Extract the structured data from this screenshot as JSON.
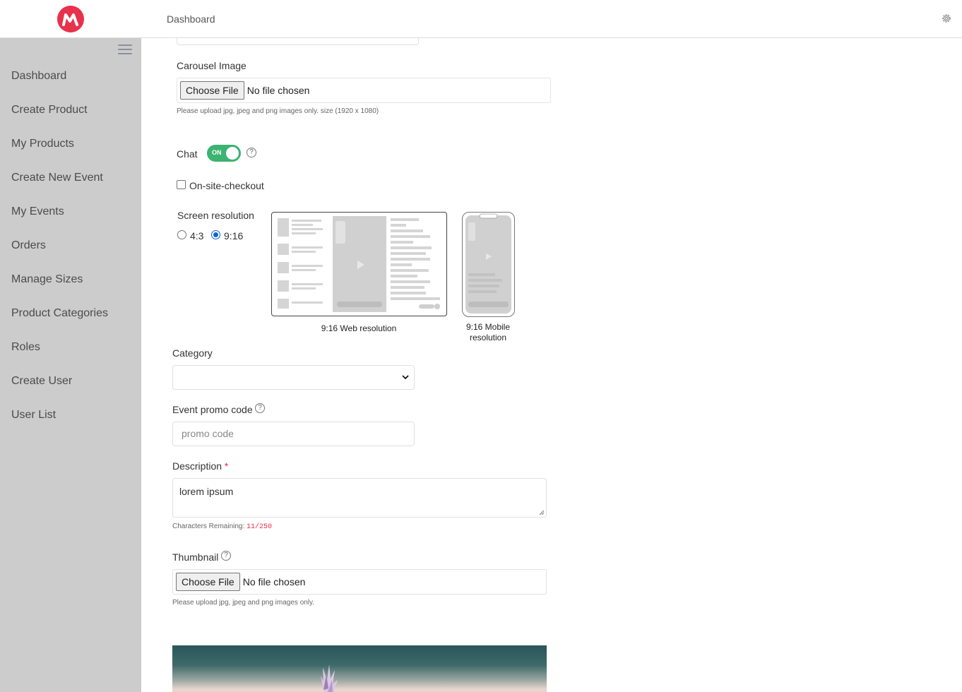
{
  "header": {
    "title": "Dashboard"
  },
  "sidebar": {
    "items": [
      {
        "label": "Dashboard"
      },
      {
        "label": "Create Product"
      },
      {
        "label": "My Products"
      },
      {
        "label": "Create New Event"
      },
      {
        "label": "My Events"
      },
      {
        "label": "Orders"
      },
      {
        "label": "Manage Sizes"
      },
      {
        "label": "Product Categories"
      },
      {
        "label": "Roles"
      },
      {
        "label": "Create User"
      },
      {
        "label": "User List"
      }
    ]
  },
  "form": {
    "carousel": {
      "label": "Carousel Image",
      "button": "Choose File",
      "status": "No file chosen",
      "hint": "Please upload jpg, jpeg and png images only. size (1920 x 1080)"
    },
    "chat": {
      "label": "Chat",
      "toggle_text": "ON",
      "on": true,
      "help": "?"
    },
    "checkout": {
      "label": "On-site-checkout",
      "checked": false
    },
    "resolution": {
      "label": "Screen resolution",
      "options": [
        "4:3",
        "9:16"
      ],
      "selected": "9:16",
      "web_caption": "9:16 Web resolution",
      "mobile_caption_line1": "9:16 Mobile",
      "mobile_caption_line2": "resolution"
    },
    "category": {
      "label": "Category",
      "value": ""
    },
    "promo": {
      "label": "Event promo code",
      "placeholder": "promo code",
      "help": "?"
    },
    "description": {
      "label": "Description",
      "required_mark": "*",
      "value": "lorem ipsum",
      "remaining_label": "Characters Remaining:",
      "remaining_value": "11/250"
    },
    "thumbnail": {
      "label": "Thumbnail",
      "help": "?",
      "button": "Choose File",
      "status": "No file chosen",
      "hint": "Please upload jpg, jpeg and png images only."
    }
  },
  "colors": {
    "brand": "#e8314a",
    "toggle": "#3cb371",
    "sidebar": "#cdcccd",
    "radio": "#0a64d6"
  },
  "icons": {
    "logo": "brand-m-logo",
    "settings": "gear-icon",
    "menu": "hamburger-icon",
    "select": "chevron-down-icon"
  }
}
